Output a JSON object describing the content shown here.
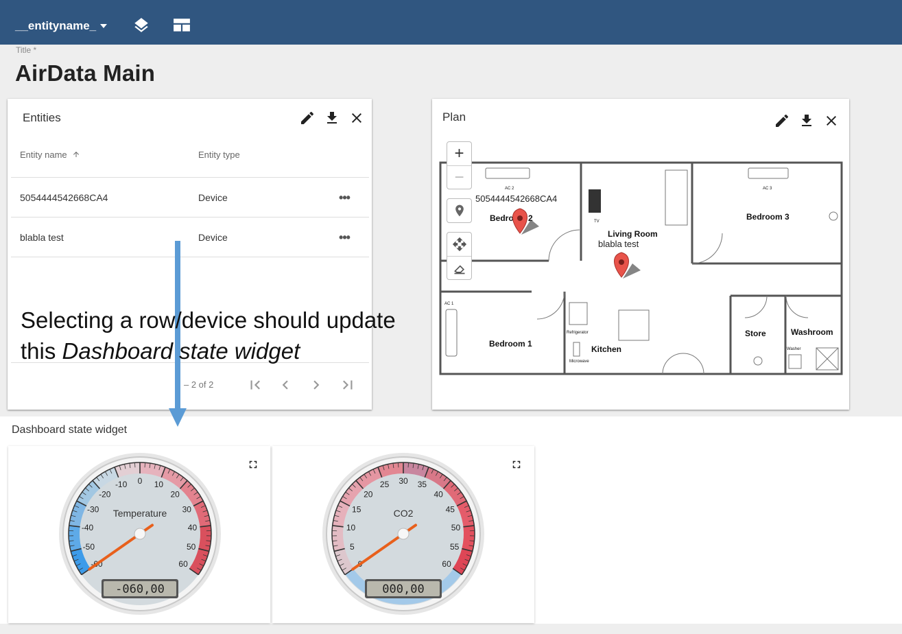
{
  "topbar": {
    "entity_selector": "__entityname_",
    "layers_icon": "layers-icon",
    "layout_icon": "layout-icon"
  },
  "title_field": {
    "label": "Title *",
    "value": "AirData Main"
  },
  "entities_widget": {
    "title": "Entities",
    "actions": [
      "edit-icon",
      "download-icon",
      "close-icon"
    ],
    "columns": [
      "Entity name",
      "Entity type"
    ],
    "rows": [
      {
        "name": "5054444542668CA4",
        "type": "Device"
      },
      {
        "name": "blabla test",
        "type": "Device"
      }
    ],
    "more_label": "•••",
    "pager": "– 2 of 2"
  },
  "annotation": {
    "line1": "Selecting a row/device should update",
    "line2_prefix": "this ",
    "line2_italic": "Dashboard state widget"
  },
  "plan_widget": {
    "title": "Plan",
    "zoom_in": "+",
    "zoom_out": "−",
    "rooms": [
      "Bedroom 2",
      "Living Room",
      "Bedroom 3",
      "Bedroom 1",
      "Kitchen",
      "Store",
      "Washroom"
    ],
    "fixtures": [
      "AC 2",
      "AC 3",
      "AC 1",
      "TV",
      "Refrigerator",
      "Microwave",
      "Washer"
    ],
    "markers": [
      {
        "label": "5054444542668CA4"
      },
      {
        "label": "blabla test"
      }
    ]
  },
  "dashboard_state": {
    "title": "Dashboard state widget",
    "gauges": [
      {
        "title": "Temperature",
        "ticks": [
          "-60",
          "-50",
          "-40",
          "-30",
          "-20",
          "-10",
          "0",
          "10",
          "20",
          "30",
          "40",
          "50",
          "60"
        ],
        "min": -60,
        "max": 60,
        "value": -60,
        "display": "-060,00"
      },
      {
        "title": "CO2",
        "ticks": [
          "0",
          "5",
          "10",
          "15",
          "20",
          "25",
          "30",
          "35",
          "40",
          "45",
          "50",
          "55",
          "60"
        ],
        "min": 0,
        "max": 60,
        "value": 0,
        "display": "000,00"
      }
    ]
  },
  "colors": {
    "topbar": "#305680",
    "accent_arrow": "#5b9bd5",
    "needle": "#e8601c",
    "marker": "#e8534a"
  }
}
